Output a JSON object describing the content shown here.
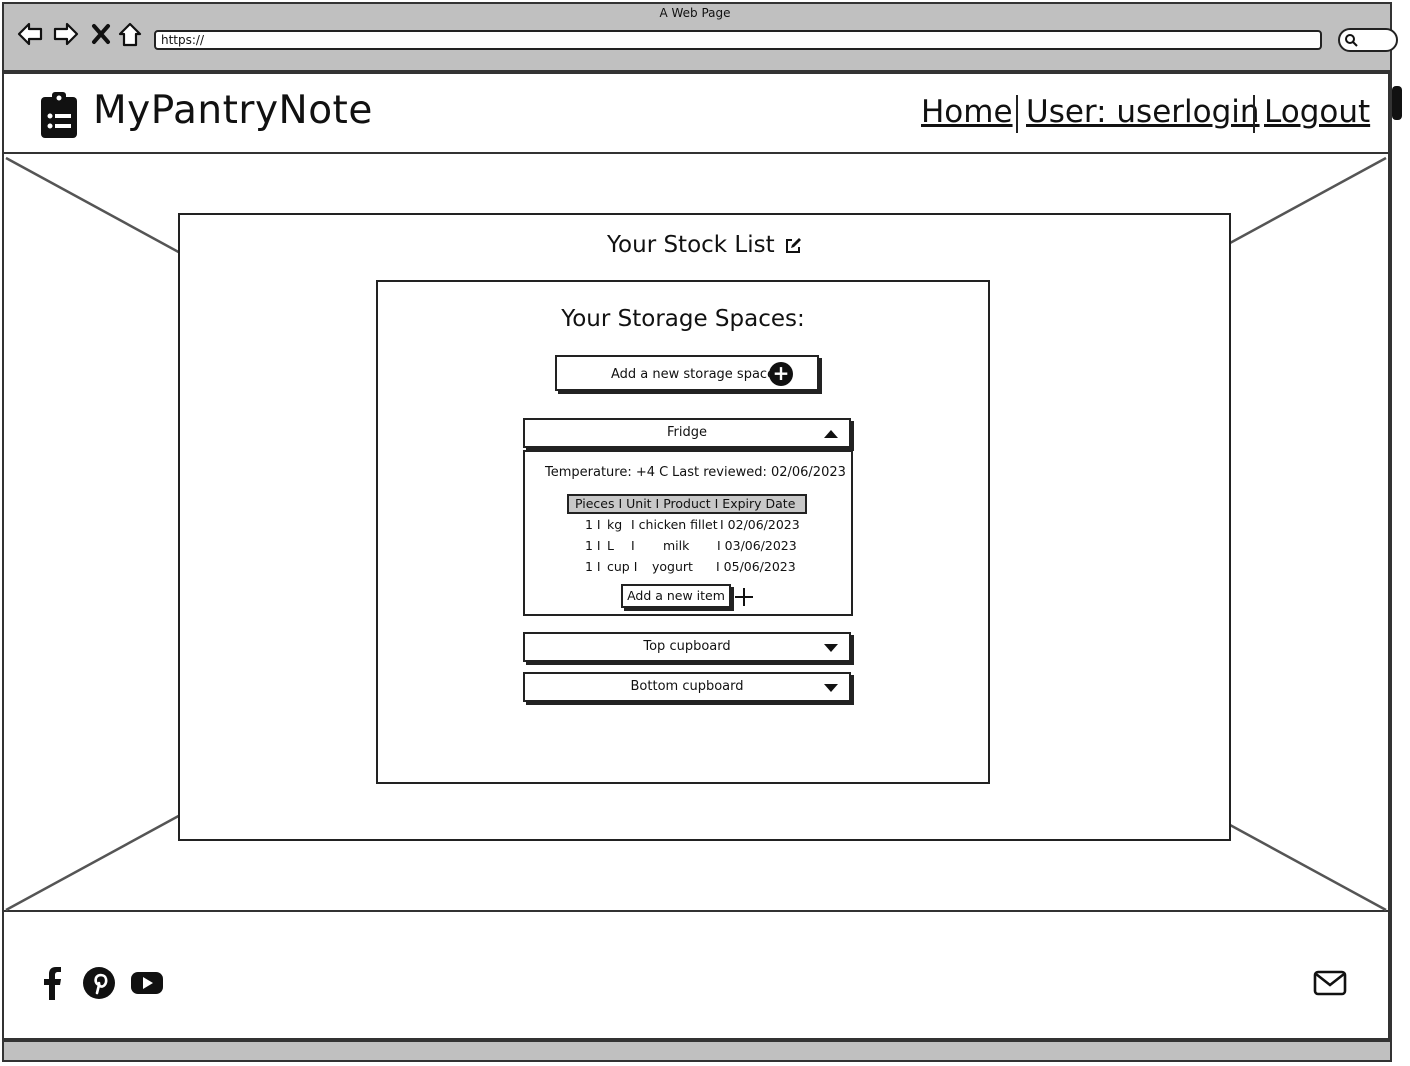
{
  "browser": {
    "window_title": "A Web Page",
    "url": "https://"
  },
  "header": {
    "brand": "MyPantryNote",
    "nav": [
      {
        "label": "Home"
      },
      {
        "label": "User: userlogin"
      },
      {
        "label": "Logout"
      }
    ]
  },
  "main": {
    "stock_title": "Your Stock List",
    "storage_title": "Your Storage Spaces:",
    "add_storage_label": "Add a new storage space!",
    "storages": [
      {
        "name": "Fridge",
        "expanded": true,
        "temperature": "Temperature: +4 C",
        "last_reviewed": "Last reviewed: 02/06/2023",
        "table_header": "Pieces I Unit I Product I Expiry Date",
        "rows": [
          {
            "pieces": "1 I",
            "unit": "kg",
            "product": "I chicken fillet",
            "expiry": "I 02/06/2023"
          },
          {
            "pieces": "1 I",
            "unit": "L",
            "sep": "I",
            "product": "milk",
            "expiry": "I 03/06/2023"
          },
          {
            "pieces": "1 I",
            "unit": "cup I",
            "product": "yogurt",
            "expiry": "I 05/06/2023"
          }
        ],
        "add_item_label": "Add a new item"
      },
      {
        "name": "Top cupboard",
        "expanded": false
      },
      {
        "name": "Bottom cupboard",
        "expanded": false
      }
    ]
  },
  "footer": {
    "social_icons": [
      "facebook-icon",
      "pinterest-icon",
      "youtube-icon"
    ],
    "contact_icon": "envelope-icon"
  },
  "colors": {
    "chrome": "#c0c0c0",
    "ink": "#111111",
    "table_header": "#c8c8c8"
  }
}
